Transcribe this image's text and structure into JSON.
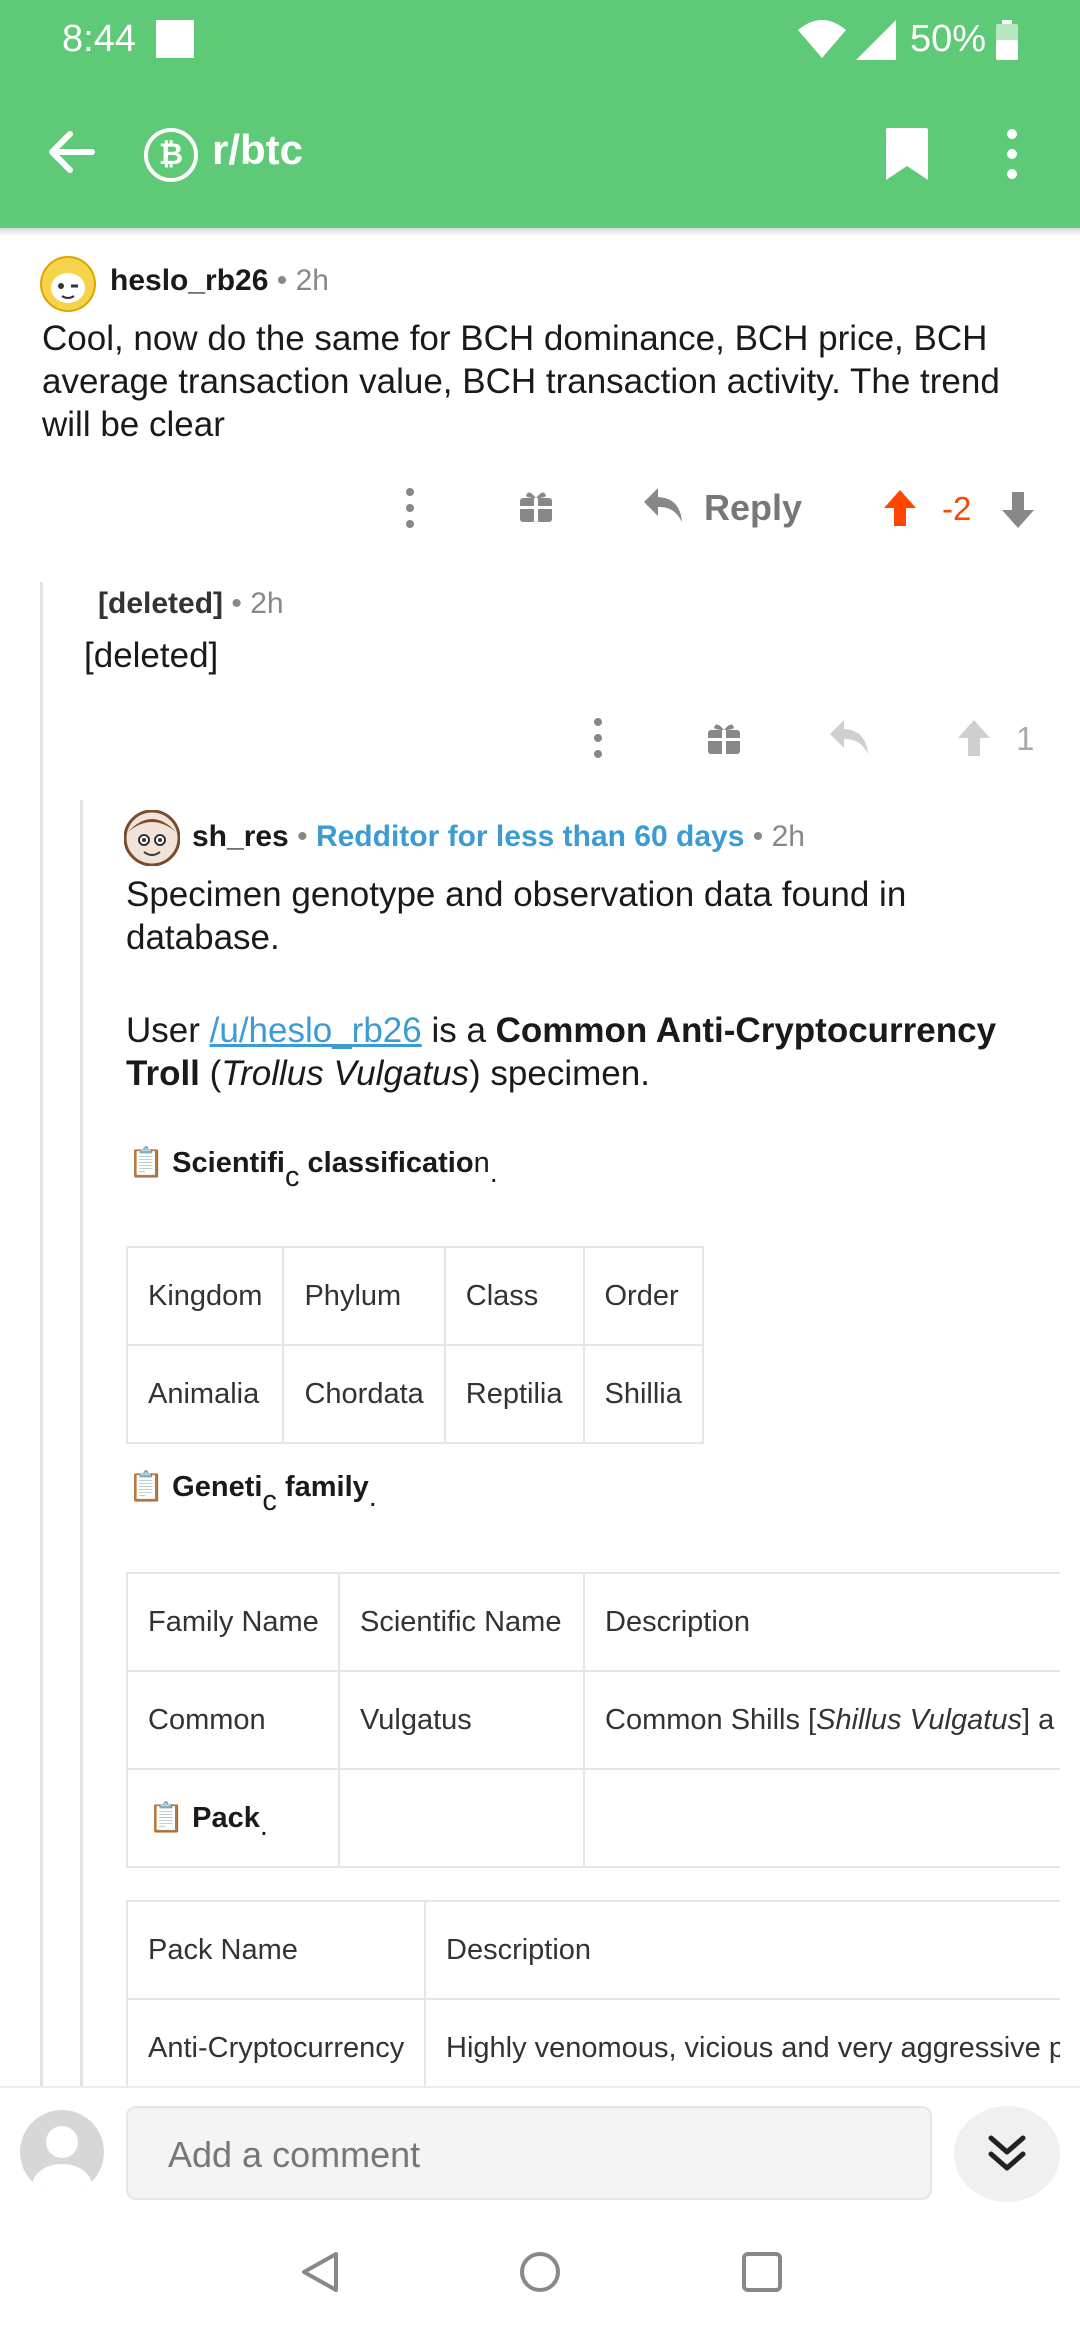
{
  "status_bar": {
    "time": "8:44",
    "battery": "50%"
  },
  "app_bar": {
    "subreddit": "r/btc",
    "badge": "₿"
  },
  "comment1": {
    "username": "heslo_rb26",
    "time": "2h",
    "body": "Cool, now do the same for BCH dominance, BCH price, BCH average transaction value, BCH transaction activity. The trend will be clear",
    "reply_label": "Reply",
    "score": "-2"
  },
  "comment2": {
    "username": "[deleted]",
    "time": "2h",
    "body": "[deleted]",
    "score": "1"
  },
  "comment3": {
    "username": "sh_res",
    "flair": "Redditor for less than 60 days",
    "time": "2h",
    "para1": "Specimen genotype and observation data found in database.",
    "para2_prefix": "User ",
    "para2_link": "/u/heslo_rb26",
    "para2_mid": " is a ",
    "para2_bold": "Common Anti-Cryptocurrency Troll",
    "para2_open": " (",
    "para2_italic": "Trollus Vulgatus",
    "para2_end": ") specimen.",
    "classification_heading_a": "Scientifi",
    "classification_heading_b": "c",
    "classification_heading_c": " classificatio",
    "classification_heading_d": "n",
    "classification_heading_e": ".",
    "classification_table": {
      "headers": [
        "Kingdom",
        "Phylum",
        "Class",
        "Order"
      ],
      "row": [
        "Animalia",
        "Chordata",
        "Reptilia",
        "Shillia"
      ]
    },
    "family_heading_a": "Geneti",
    "family_heading_b": "c",
    "family_heading_c": " family",
    "family_heading_d": ".",
    "family_table": {
      "headers": [
        "Family Name",
        "Scientific Name",
        "Description"
      ],
      "row_name": "Common",
      "row_sci": "Vulgatus",
      "row_desc_prefix": "Common Shills [",
      "row_desc_italic": "Shillus Vulgatus",
      "row_desc_suffix": "] a",
      "pack_label_a": "Pack",
      "pack_label_b": "."
    },
    "pack_table": {
      "headers": [
        "Pack Name",
        "Description"
      ],
      "row": [
        "Anti-Cryptocurrency",
        "Highly venomous, vicious and very aggressive p"
      ]
    }
  },
  "comment_input": {
    "placeholder": "Add a comment"
  },
  "colors": {
    "brand_green": "#5ec977",
    "upvote_orange": "#ff4500",
    "flair_blue": "#3d9bd4"
  }
}
